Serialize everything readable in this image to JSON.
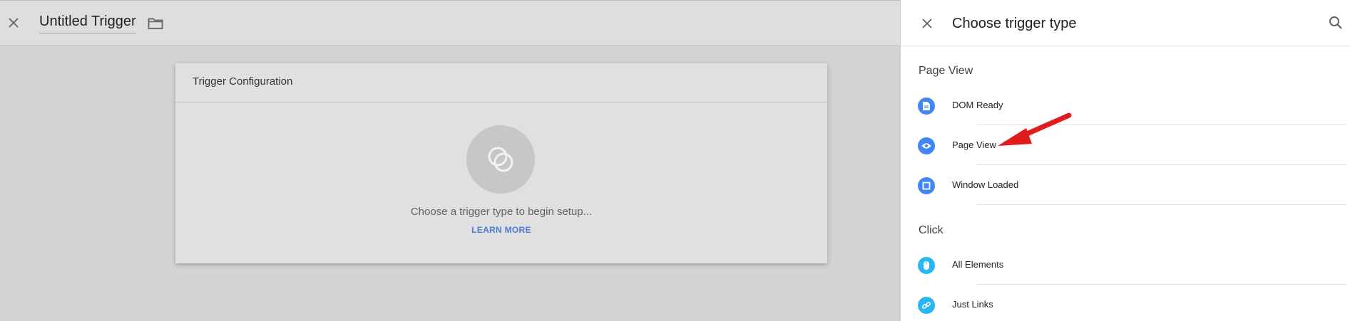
{
  "editor": {
    "title": "Untitled Trigger"
  },
  "config": {
    "heading": "Trigger Configuration",
    "message": "Choose a trigger type to begin setup...",
    "learn_more": "LEARN MORE"
  },
  "panel": {
    "title": "Choose trigger type",
    "sections": [
      {
        "title": "Page View",
        "items": [
          {
            "label": "DOM Ready",
            "icon": "document-icon",
            "color": "#4285f4"
          },
          {
            "label": "Page View",
            "icon": "eye-icon",
            "color": "#4285f4"
          },
          {
            "label": "Window Loaded",
            "icon": "window-icon",
            "color": "#4285f4"
          }
        ]
      },
      {
        "title": "Click",
        "items": [
          {
            "label": "All Elements",
            "icon": "mouse-icon",
            "color": "#29b6f6"
          },
          {
            "label": "Just Links",
            "icon": "link-icon",
            "color": "#29b6f6"
          }
        ]
      }
    ]
  },
  "annotation": {
    "arrow_color": "#e11b1b"
  }
}
